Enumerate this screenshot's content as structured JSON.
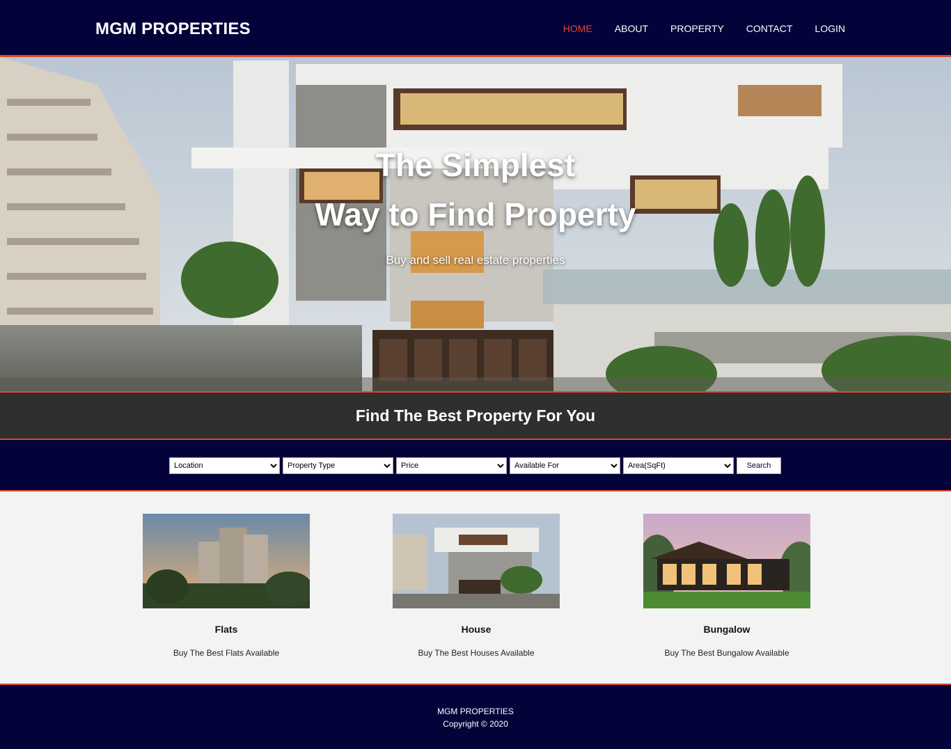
{
  "header": {
    "logo": "MGM PROPERTIES",
    "nav": [
      {
        "label": "HOME",
        "active": true
      },
      {
        "label": "ABOUT",
        "active": false
      },
      {
        "label": "PROPERTY",
        "active": false
      },
      {
        "label": "CONTACT",
        "active": false
      },
      {
        "label": "LOGIN",
        "active": false
      }
    ]
  },
  "hero": {
    "title_line1": "The Simplest",
    "title_line2": "Way to Find Property",
    "subtitle": "Buy and sell real estate properties"
  },
  "find_band": {
    "heading": "Find The Best Property For You"
  },
  "search": {
    "filters": [
      "Location",
      "Property Type",
      "Price",
      "Available For",
      "Area(SqFt)"
    ],
    "button_label": "Search"
  },
  "cards": [
    {
      "title": "Flats",
      "description": "Buy The Best Flats Available",
      "image": "apartment-tower-photo"
    },
    {
      "title": "House",
      "description": "Buy The Best Houses Available",
      "image": "modern-house-photo"
    },
    {
      "title": "Bungalow",
      "description": "Buy The Best Bungalow Available",
      "image": "bungalow-photo"
    }
  ],
  "footer": {
    "brand": "MGM PROPERTIES",
    "copyright": "Copyright © 2020"
  },
  "colors": {
    "navy": "#03033a",
    "accent": "#e4472a",
    "band_dark": "#2f2f2f",
    "page_bg": "#f3f3f3"
  }
}
